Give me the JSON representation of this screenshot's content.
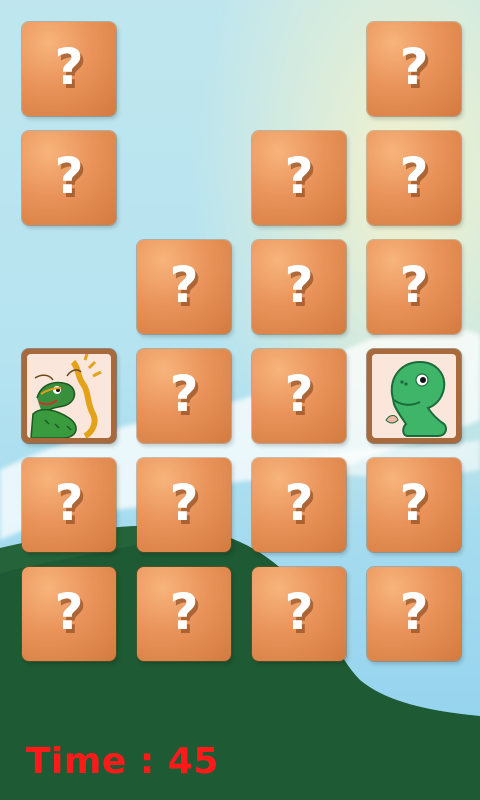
{
  "game": {
    "hidden_card_mark": "?",
    "time_label": "Time : 45"
  },
  "board": {
    "columns": 4,
    "rows": 6,
    "cards": [
      {
        "row": 1,
        "col": 1,
        "state": "hidden"
      },
      {
        "row": 1,
        "col": 4,
        "state": "hidden"
      },
      {
        "row": 2,
        "col": 1,
        "state": "hidden"
      },
      {
        "row": 2,
        "col": 3,
        "state": "hidden"
      },
      {
        "row": 2,
        "col": 4,
        "state": "hidden"
      },
      {
        "row": 3,
        "col": 2,
        "state": "hidden"
      },
      {
        "row": 3,
        "col": 3,
        "state": "hidden"
      },
      {
        "row": 3,
        "col": 4,
        "state": "hidden"
      },
      {
        "row": 4,
        "col": 1,
        "state": "revealed",
        "picture": "chinese-dragon-icon"
      },
      {
        "row": 4,
        "col": 2,
        "state": "hidden"
      },
      {
        "row": 4,
        "col": 3,
        "state": "hidden"
      },
      {
        "row": 4,
        "col": 4,
        "state": "revealed",
        "picture": "green-dinosaur-icon"
      },
      {
        "row": 5,
        "col": 1,
        "state": "hidden"
      },
      {
        "row": 5,
        "col": 2,
        "state": "hidden"
      },
      {
        "row": 5,
        "col": 3,
        "state": "hidden"
      },
      {
        "row": 5,
        "col": 4,
        "state": "hidden"
      },
      {
        "row": 6,
        "col": 1,
        "state": "hidden"
      },
      {
        "row": 6,
        "col": 2,
        "state": "hidden"
      },
      {
        "row": 6,
        "col": 3,
        "state": "hidden"
      },
      {
        "row": 6,
        "col": 4,
        "state": "hidden"
      }
    ]
  },
  "colors": {
    "timer_text": "#ff1a1a",
    "card_face": "#e9935a",
    "hill": "#1e5a34",
    "sky": "#aee0f0"
  }
}
